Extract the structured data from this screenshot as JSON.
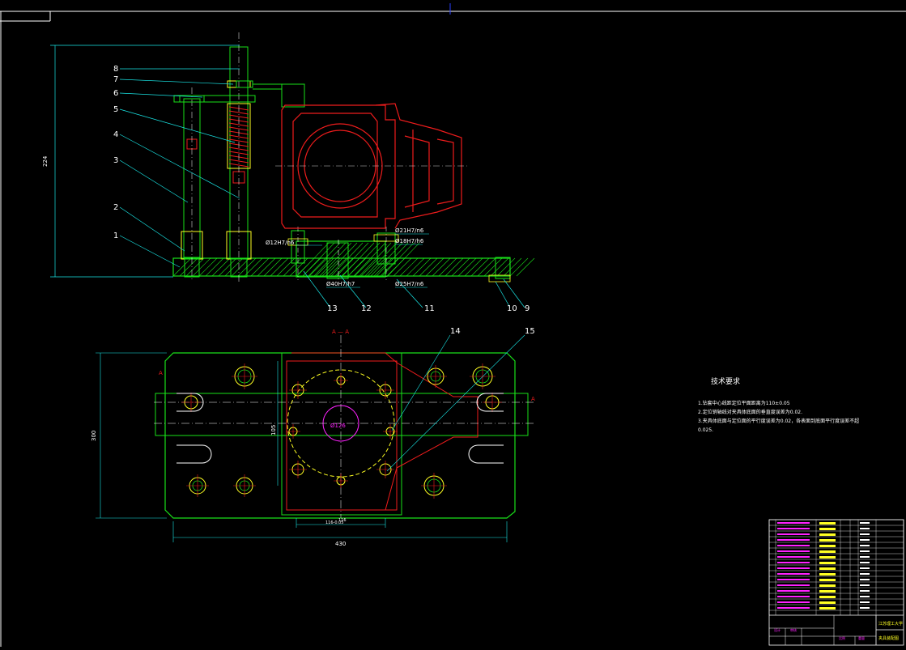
{
  "colors": {
    "background": "#000000",
    "frame": "#ffffff",
    "green": "#19e019",
    "red": "#ee1c1c",
    "cyan": "#19e5e5",
    "yellow": "#ffff22",
    "white": "#ffffff",
    "magenta": "#ff22ff",
    "blue": "#2a3fff",
    "dim": "#808080"
  },
  "leaders": [
    {
      "id": "1",
      "label": "1"
    },
    {
      "id": "2",
      "label": "2"
    },
    {
      "id": "3",
      "label": "3"
    },
    {
      "id": "4",
      "label": "4"
    },
    {
      "id": "5",
      "label": "5"
    },
    {
      "id": "6",
      "label": "6"
    },
    {
      "id": "7",
      "label": "7"
    },
    {
      "id": "8",
      "label": "8"
    },
    {
      "id": "9",
      "label": "9"
    },
    {
      "id": "10",
      "label": "10"
    },
    {
      "id": "11",
      "label": "11"
    },
    {
      "id": "12",
      "label": "12"
    },
    {
      "id": "13",
      "label": "13"
    },
    {
      "id": "14",
      "label": "14"
    },
    {
      "id": "15",
      "label": "15"
    }
  ],
  "dimensions": {
    "height_total": "224",
    "fit_12": "Ø12H7/n6",
    "fit_21": "Ø21H7/n6",
    "fit_18": "Ø18H7/h6",
    "fit_40": "Ø40H7/h7",
    "fit_25": "Ø25H7/n6",
    "plan_width": "430",
    "plan_height": "300",
    "bore": "Ø126",
    "inner_span": "116",
    "inner_span_tol": "116-0.05",
    "side_dim": "105"
  },
  "section_marks": {
    "title": "A — A",
    "left": "A",
    "right": "A"
  },
  "tech_notes": {
    "heading": "技术要求",
    "lines": [
      "1.钻套中心线距定位平面距离为110±0.05",
      "2.定位销轴线对夹具体底面的垂直度误差为0.02.",
      "3.夹具体底面与定位面的平行度误差为0.02，各表面到底面平行度误差不超",
      "0.025."
    ]
  },
  "title_block": {
    "school": "江苏理工大学",
    "drawing_title": "夹具装配图",
    "cells": [
      "设计",
      "审核",
      "比例",
      "重量"
    ]
  }
}
